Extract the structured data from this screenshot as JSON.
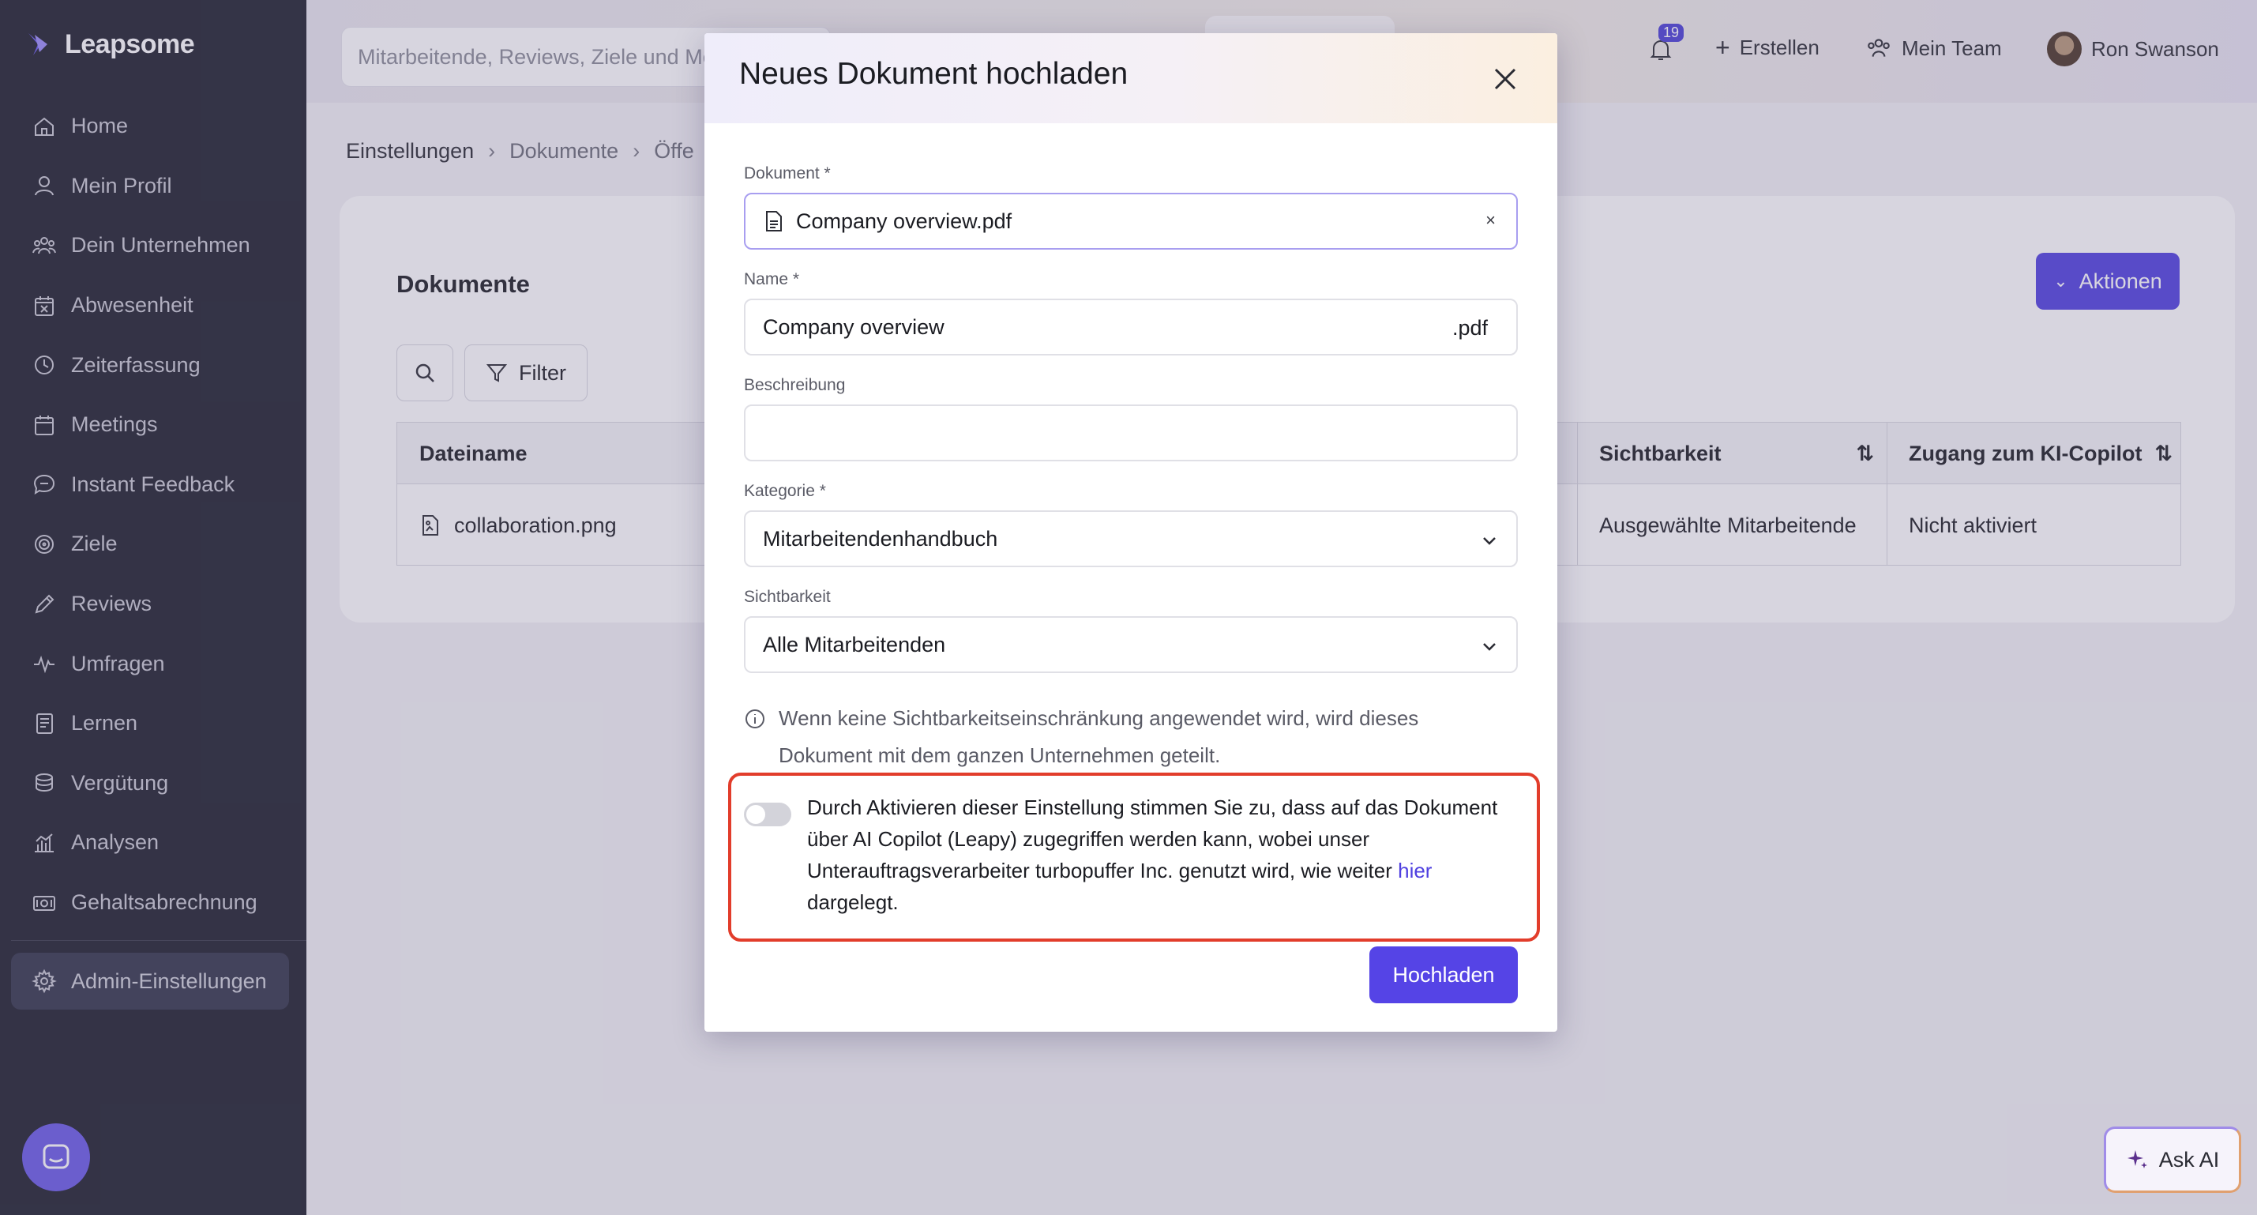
{
  "brand": {
    "name": "Leapsome",
    "accent": "#4f40e0"
  },
  "sidebar": {
    "items": [
      {
        "label": "Home",
        "icon": "home-icon"
      },
      {
        "label": "Mein Profil",
        "icon": "user-icon"
      },
      {
        "label": "Dein Unternehmen",
        "icon": "people-icon"
      },
      {
        "label": "Abwesenheit",
        "icon": "calendar-x-icon"
      },
      {
        "label": "Zeiterfassung",
        "icon": "clock-icon"
      },
      {
        "label": "Meetings",
        "icon": "calendar-icon"
      },
      {
        "label": "Instant Feedback",
        "icon": "chat-icon"
      },
      {
        "label": "Ziele",
        "icon": "target-icon"
      },
      {
        "label": "Reviews",
        "icon": "pencil-icon"
      },
      {
        "label": "Umfragen",
        "icon": "pulse-icon"
      },
      {
        "label": "Lernen",
        "icon": "book-icon"
      },
      {
        "label": "Vergütung",
        "icon": "coins-icon"
      },
      {
        "label": "Analysen",
        "icon": "chart-icon"
      },
      {
        "label": "Gehaltsabrechnung",
        "icon": "cash-icon"
      }
    ],
    "admin_label": "Admin-Einstellungen"
  },
  "topbar": {
    "search_placeholder": "Mitarbeitende, Reviews, Ziele und Me",
    "notification_count": "19",
    "create_label": "Erstellen",
    "team_label": "Mein Team",
    "user_name": "Ron Swanson"
  },
  "breadcrumb": {
    "items": [
      "Einstellungen",
      "Dokumente",
      "Öffe"
    ]
  },
  "documents": {
    "title": "Dokumente",
    "actions_label": "Aktionen",
    "filter_label": "Filter",
    "columns": [
      "Dateiname",
      "Sichtbarkeit",
      "Zugang zum KI-Copilot"
    ],
    "rows": [
      {
        "filename": "collaboration.png",
        "visibility": "Ausgewählte Mitarbeitende",
        "copilot": "Nicht aktiviert"
      }
    ]
  },
  "modal": {
    "title": "Neues Dokument hochladen",
    "document_label": "Dokument *",
    "document_value": "Company overview.pdf",
    "clear_symbol": "×",
    "name_label": "Name *",
    "name_value": "Company overview",
    "name_suffix": ".pdf",
    "description_label": "Beschreibung",
    "description_value": "",
    "category_label": "Kategorie *",
    "category_value": "Mitarbeitendenhandbuch",
    "visibility_label": "Sichtbarkeit",
    "visibility_value": "Alle Mitarbeitenden",
    "info_text": "Wenn keine Sichtbarkeitseinschränkung angewendet wird, wird dieses Dokument mit dem ganzen Unternehmen geteilt.",
    "consent_text_before": "Durch Aktivieren dieser Einstellung stimmen Sie zu, dass auf das Dokument über AI Copilot (Leapy) zugegriffen werden kann, wobei unser Unterauftragsverarbeiter turbopuffer Inc. genutzt wird, wie weiter ",
    "consent_link": "hier",
    "consent_text_after": " dargelegt.",
    "consent_enabled": false,
    "upload_label": "Hochladen"
  },
  "ask_ai_label": "Ask AI"
}
